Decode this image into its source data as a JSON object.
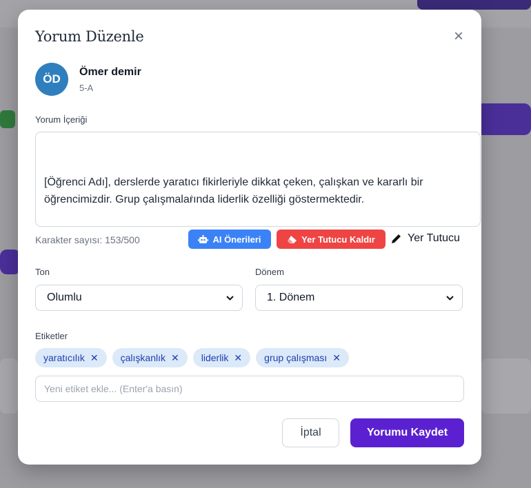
{
  "modal": {
    "title": "Yorum Düzenle",
    "close_icon": "×"
  },
  "student": {
    "initials": "ÖD",
    "name": "Ömer demir",
    "class": "5-A"
  },
  "comment": {
    "label": "Yorum İçeriği",
    "text": "[Öğrenci Adı], derslerde yaratıcı fikirleriyle dikkat çeken, çalışkan ve kararlı bir öğrencimizdir. Grup çalışmalarında liderlik özelliği göstermektedir.",
    "char_count": "Karakter sayısı: 153/500"
  },
  "actions": {
    "ai_label": "AI Önerileri",
    "remove_placeholder_label": "Yer Tutucu Kaldır",
    "placeholder_label": "Yer Tutucu"
  },
  "fields": {
    "tone_label": "Ton",
    "tone_value": "Olumlu",
    "term_label": "Dönem",
    "term_value": "1. Dönem"
  },
  "tags": {
    "label": "Etiketler",
    "items": [
      "yaratıcılık",
      "çalışkanlık",
      "liderlik",
      "grup çalışması"
    ],
    "input_placeholder": "Yeni etiket ekle... (Enter'a basın)"
  },
  "footer": {
    "cancel_label": "İptal",
    "save_label": "Yorumu Kaydet"
  },
  "colors": {
    "avatar": "#2f7fbf",
    "ai_button": "#3b82f6",
    "remove_button": "#ef4444",
    "save_button": "#5b21d1",
    "tag_bg": "#dbe9f9"
  }
}
